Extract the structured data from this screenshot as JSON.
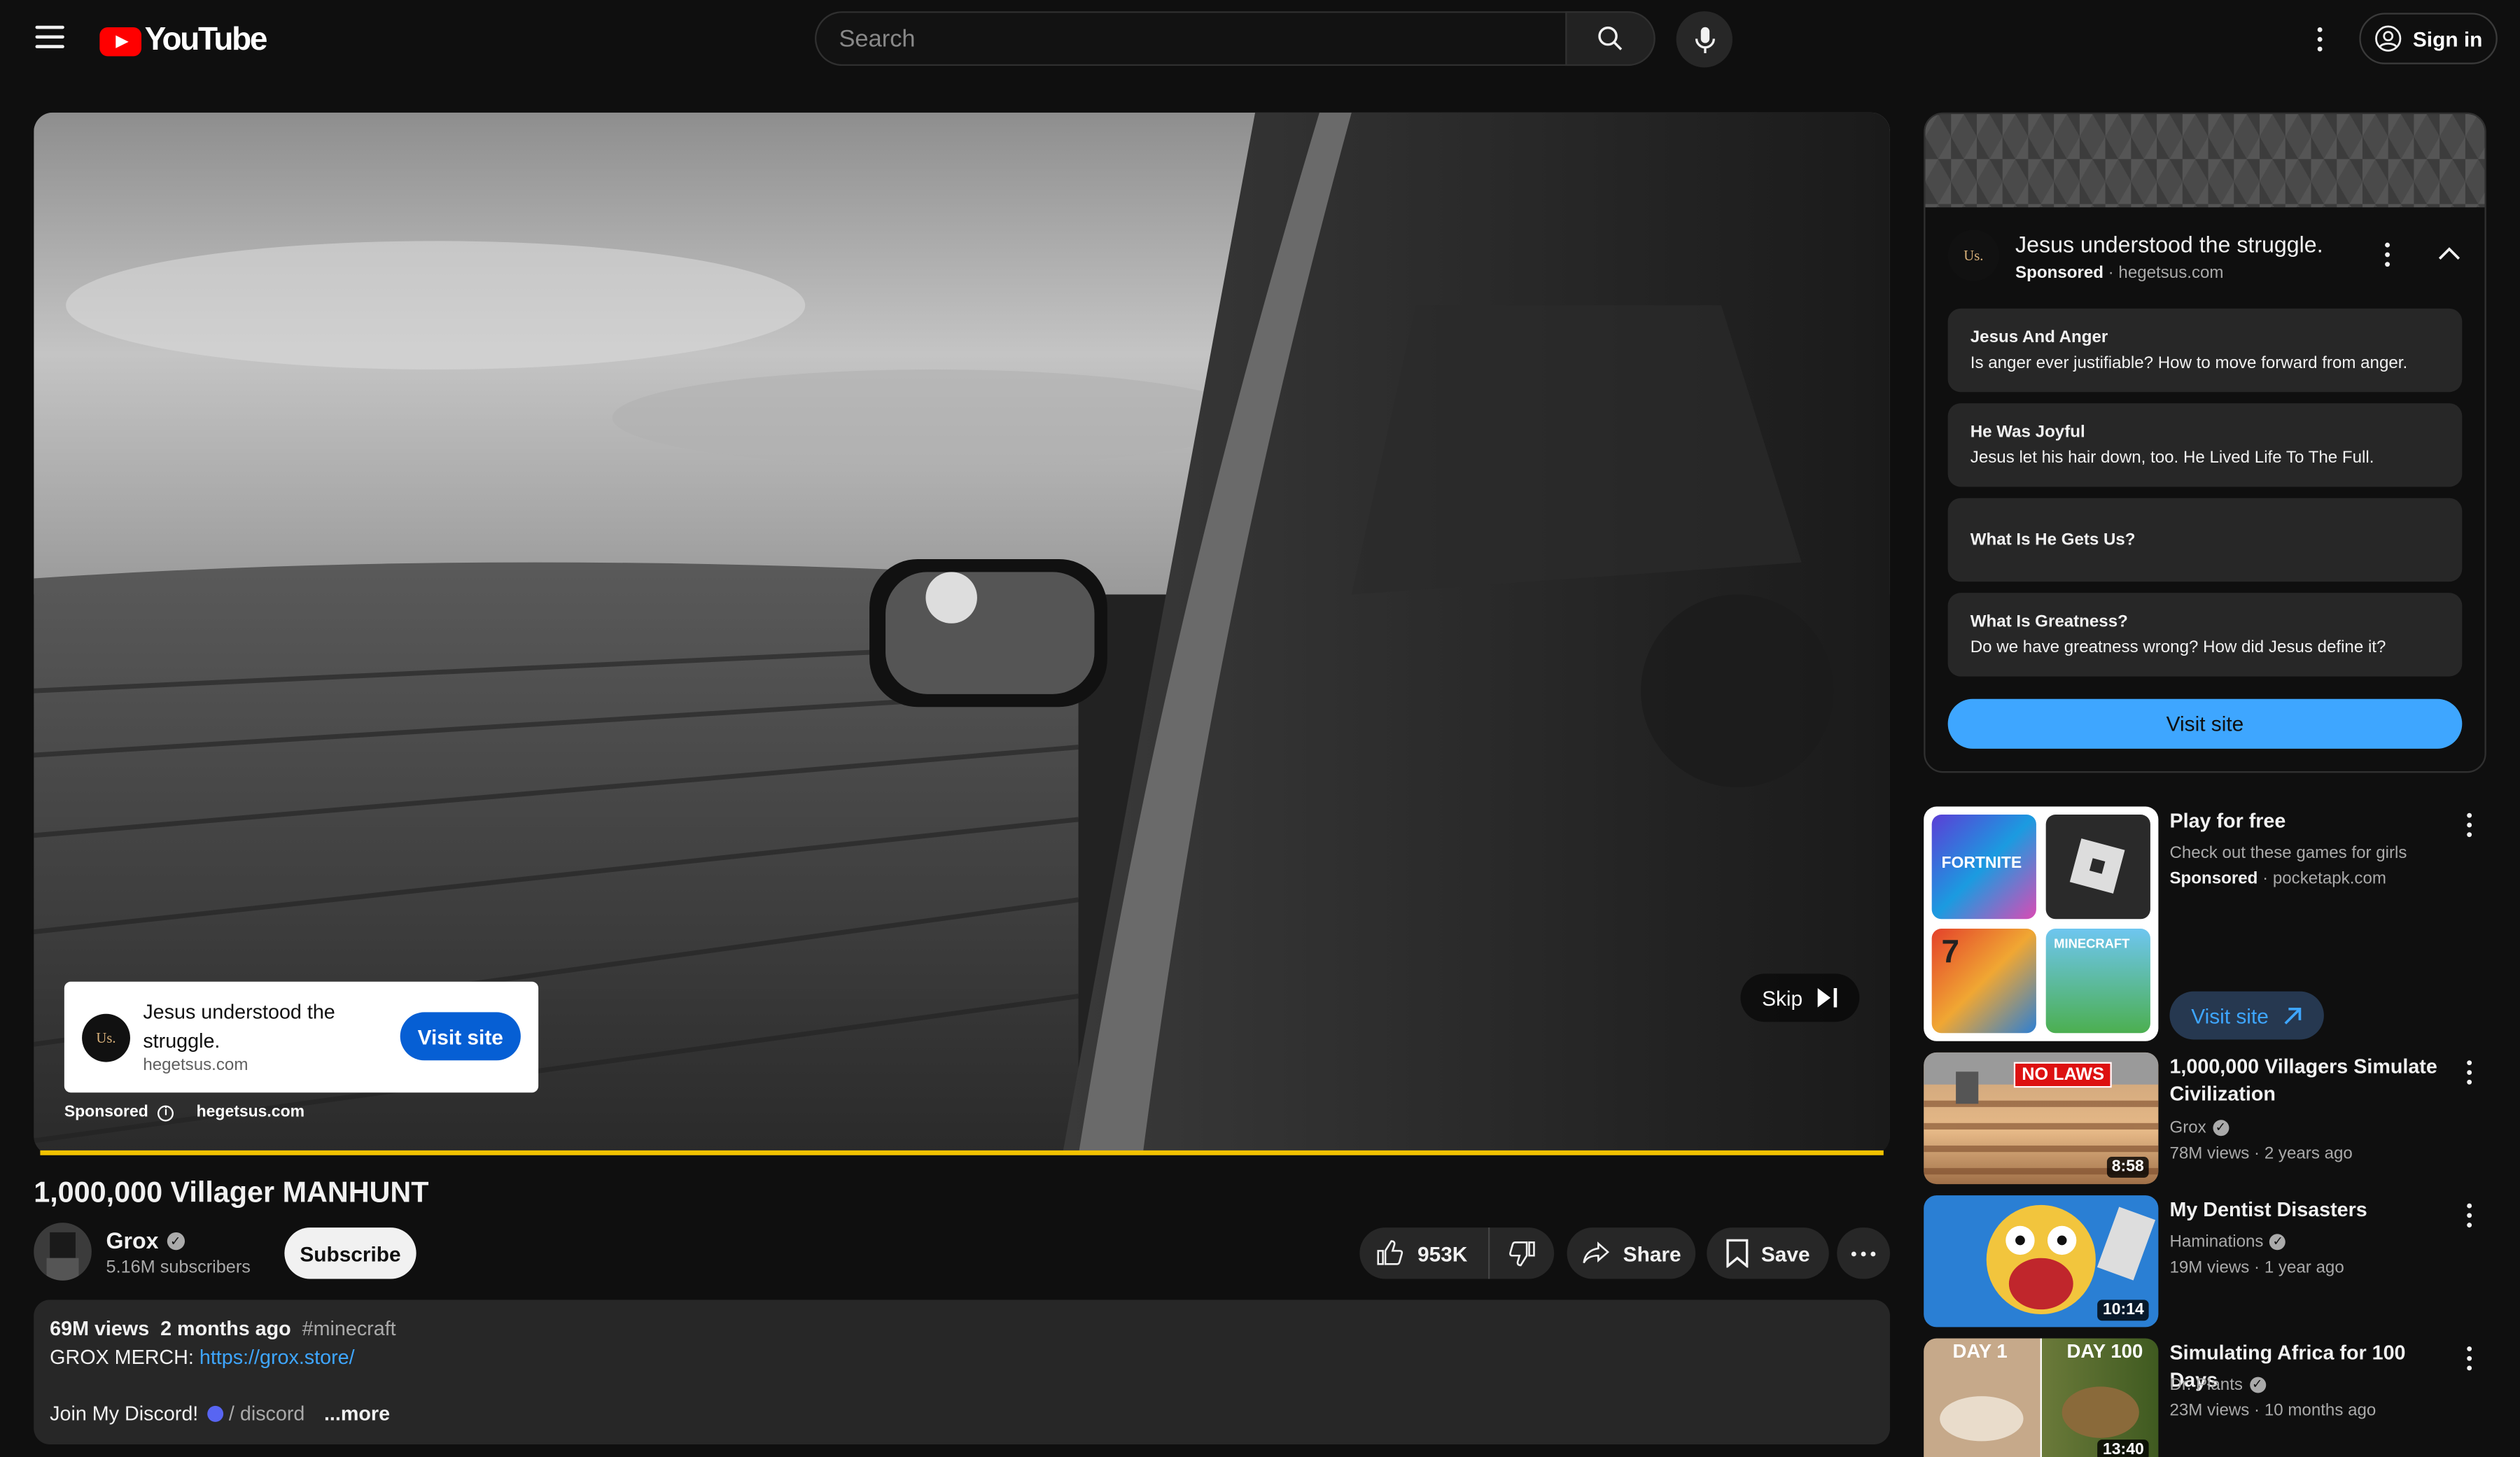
{
  "header": {
    "logo_text": "YouTube",
    "search_placeholder": "Search",
    "sign_in": "Sign in"
  },
  "video": {
    "title": "1,000,000 Villager MANHUNT",
    "channel": "Grox",
    "subscribers": "5.16M subscribers",
    "subscribe": "Subscribe",
    "likes": "953K",
    "share": "Share",
    "save": "Save"
  },
  "player_ad": {
    "logo": "Us.",
    "headline": "Jesus understood the struggle.",
    "domain": "hegetsus.com",
    "visit": "Visit site",
    "sponsored": "Sponsored",
    "skip": "Skip",
    "progress": 1.0
  },
  "description": {
    "views": "69M views",
    "date": "2 months ago",
    "hashtag": "#minecraft",
    "merch_label": "GROX MERCH:",
    "merch_link": "https://grox.store/",
    "discord_label": "Join My Discord!",
    "discord_link": "/ discord",
    "more": "...more"
  },
  "side_ad": {
    "logo": "Us.",
    "title": "Jesus understood the struggle.",
    "sponsored": "Sponsored",
    "domain": "hegetsus.com",
    "cards": [
      {
        "title": "Jesus And Anger",
        "text": "Is anger ever justifiable? How to move forward from anger."
      },
      {
        "title": "He Was Joyful",
        "text": "Jesus let his hair down, too. He Lived Life To The Full."
      },
      {
        "title": "What Is He Gets Us?",
        "text": ""
      },
      {
        "title": "What Is Greatness?",
        "text": "Do we have greatness wrong? How did Jesus define it?"
      }
    ],
    "visit": "Visit site"
  },
  "games_ad": {
    "title": "Play for free",
    "subtitle": "Check out these games for girls",
    "sponsored": "Sponsored",
    "domain": "pocketapk.com",
    "visit": "Visit site",
    "tiles": [
      "FORTNITE",
      "",
      "",
      "MINECRAFT"
    ]
  },
  "recommendations": [
    {
      "title": "1,000,000 Villagers Simulate Civilization",
      "channel": "Grox",
      "views": "78M views",
      "age": "2 years ago",
      "duration": "8:58",
      "badge": "NO LAWS"
    },
    {
      "title": "My Dentist Disasters",
      "channel": "Haminations",
      "views": "19M views",
      "age": "1 year ago",
      "duration": "10:14"
    },
    {
      "title": "Simulating Africa for 100 Days",
      "channel": "Dr. Plants",
      "views": "23M views",
      "age": "10 months ago",
      "duration": "13:40",
      "label_left": "DAY 1",
      "label_right": "DAY 100"
    }
  ],
  "colors": {
    "accent_red": "#ff0000",
    "link_blue": "#3ea6ff",
    "cta_blue": "#065fd4",
    "progress_yellow": "#f2c200"
  }
}
